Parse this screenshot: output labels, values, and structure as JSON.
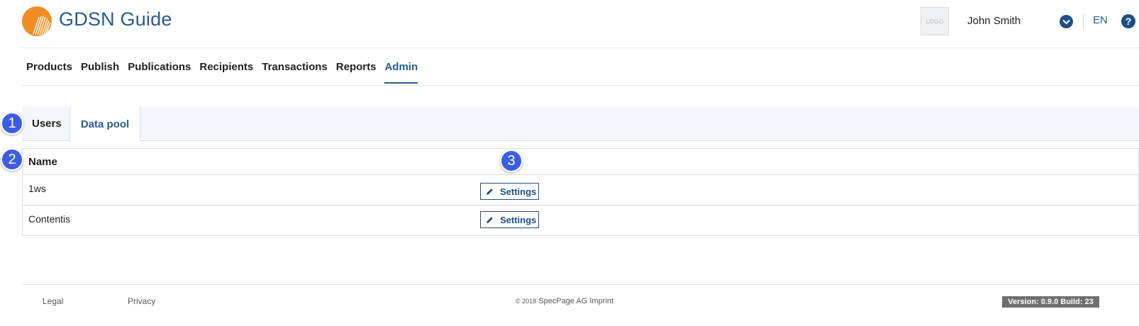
{
  "header": {
    "brand": "GDSN Guide",
    "company_logo": "LOGO",
    "user_name": "John Smith",
    "language": "EN",
    "help_label": "?"
  },
  "main_nav": [
    {
      "label": "Products",
      "active": false
    },
    {
      "label": "Publish",
      "active": false
    },
    {
      "label": "Publications",
      "active": false
    },
    {
      "label": "Recipients",
      "active": false
    },
    {
      "label": "Transactions",
      "active": false
    },
    {
      "label": "Reports",
      "active": false
    },
    {
      "label": "Admin",
      "active": true
    }
  ],
  "tabs": [
    {
      "label": "Users",
      "active": false
    },
    {
      "label": "Data pool",
      "active": true
    }
  ],
  "table": {
    "columns": [
      "Name"
    ],
    "rows": [
      {
        "name": "1ws",
        "action": "Settings"
      },
      {
        "name": "Contentis",
        "action": "Settings"
      }
    ]
  },
  "annotations": [
    "1",
    "2",
    "3"
  ],
  "footer": {
    "legal": "Legal",
    "privacy": "Privacy",
    "copyright_year": "© 2018",
    "copyright_text": "SpecPage AG Imprint",
    "version": "Version: 0.9.0  Build: 23"
  },
  "colors": {
    "brand_blue": "#2a5a8c",
    "logo_orange": "#ef8d22",
    "badge_blue": "#3d5de0"
  }
}
